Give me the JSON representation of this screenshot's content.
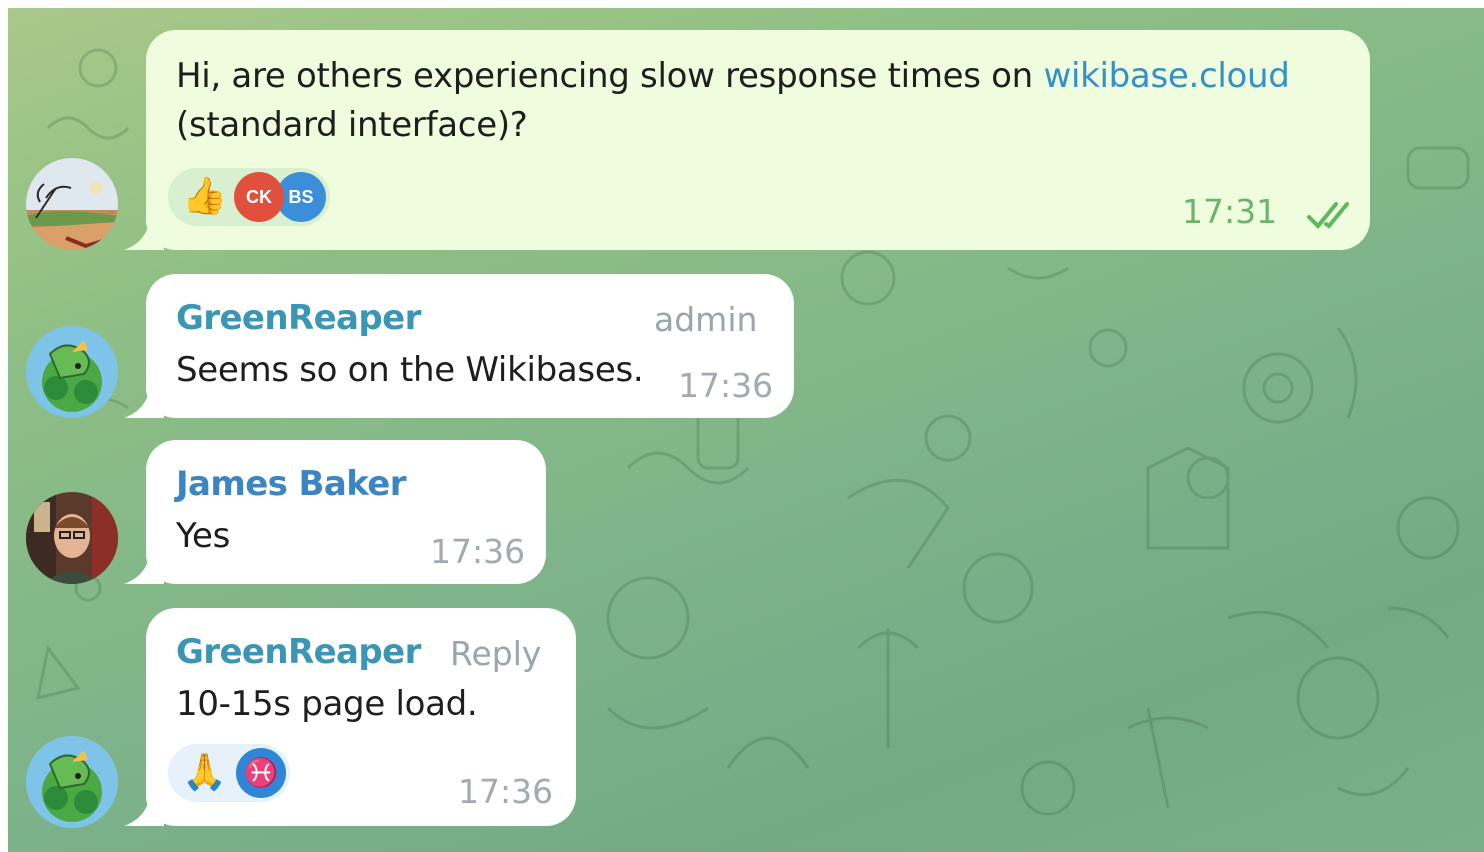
{
  "messages": [
    {
      "id": "m1",
      "direction": "outgoing",
      "text_before_link": "Hi, are others experiencing slow response times on ",
      "link_text": "wikibase.cloud",
      "text_after_link": "(standard interface)?",
      "time": "17:31",
      "status": "read",
      "reactions": {
        "emoji": "👍",
        "users": [
          {
            "initials": "CK",
            "color": "#e0503c"
          },
          {
            "initials": "BS",
            "color": "#3d8ed8"
          }
        ]
      }
    },
    {
      "id": "m2",
      "direction": "incoming",
      "sender": "GreenReaper",
      "badge": "admin",
      "text": "Seems so on the Wikibases.",
      "time": "17:36"
    },
    {
      "id": "m3",
      "direction": "incoming",
      "sender": "James Baker",
      "text": "Yes",
      "time": "17:36"
    },
    {
      "id": "m4",
      "direction": "incoming",
      "sender": "GreenReaper",
      "action": "Reply",
      "text": "10-15s page load.",
      "time": "17:36",
      "reactions": {
        "emoji": "🙏",
        "users": [
          {
            "initials": "♓",
            "color": "#2f86d6"
          }
        ]
      }
    }
  ],
  "colors": {
    "outgoing_bubble": "#effdde",
    "incoming_bubble": "#ffffff",
    "sender_name": "#3a96b4",
    "link": "#3390c8",
    "read_check": "#5cb85c"
  },
  "icons": [
    "double-check-icon",
    "avatar-landscape-icon",
    "avatar-dragon-icon",
    "avatar-photo-icon"
  ]
}
